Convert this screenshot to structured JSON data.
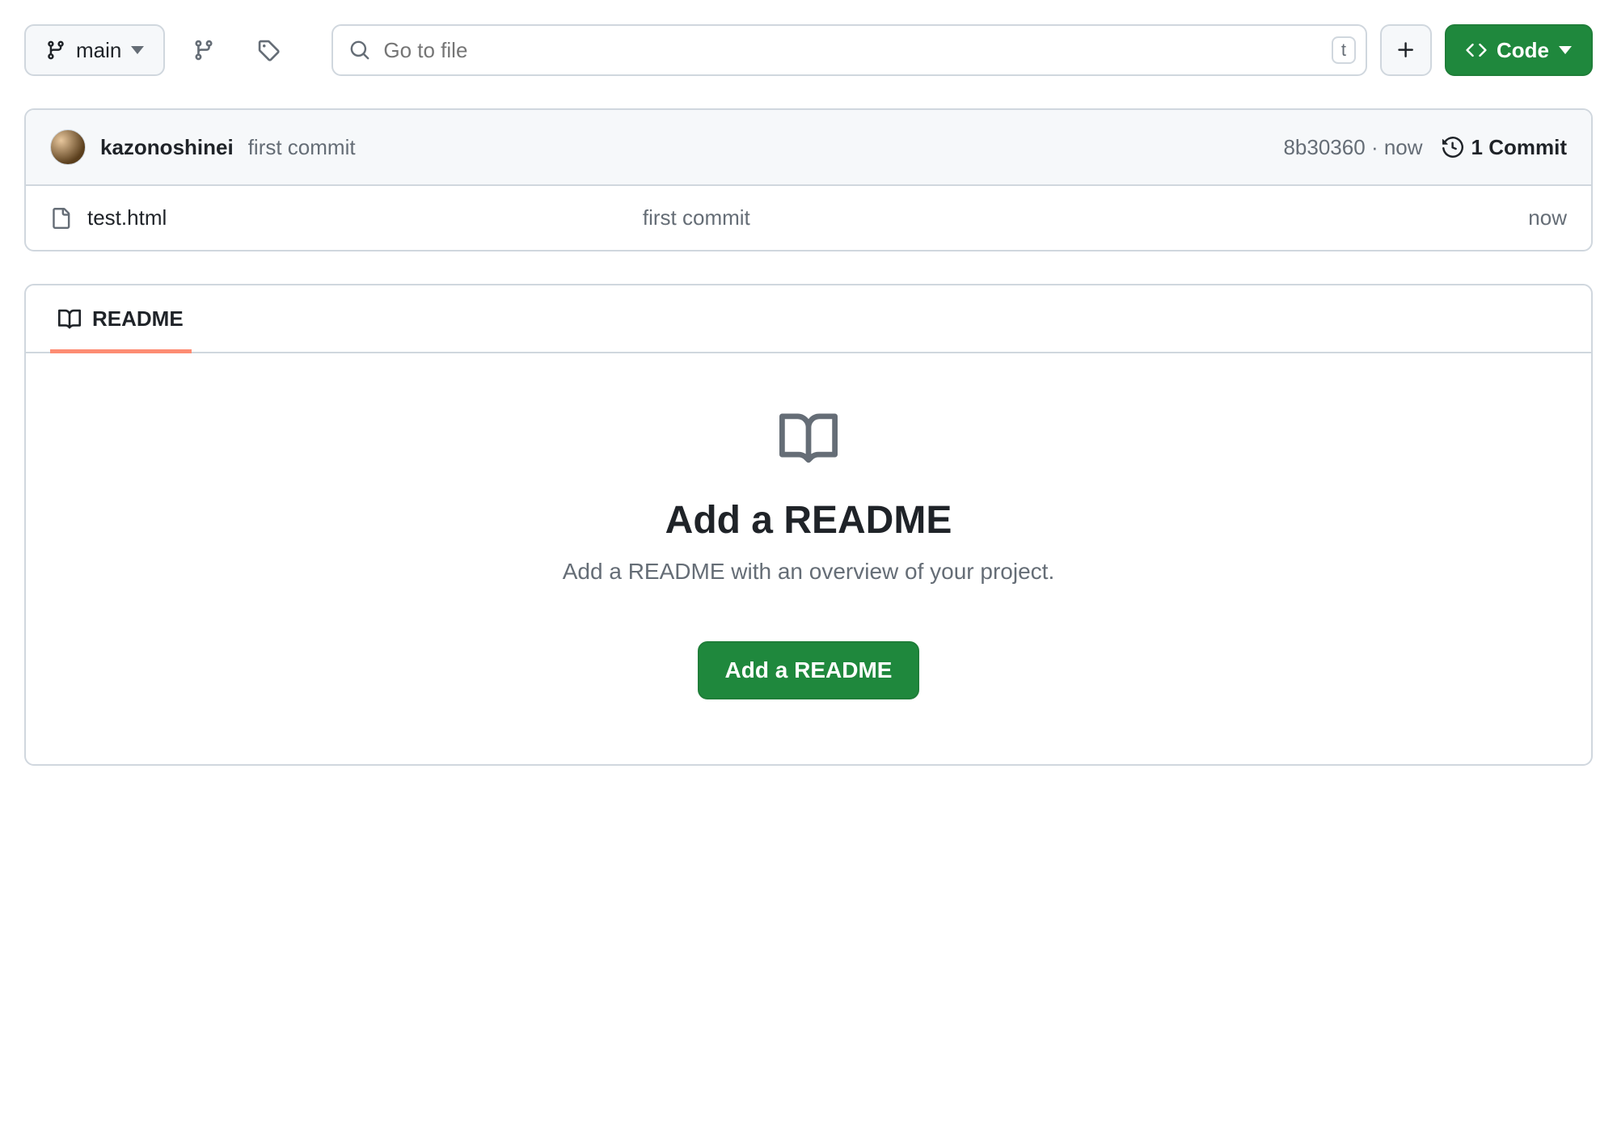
{
  "toolbar": {
    "branch_label": "main",
    "search_placeholder": "Go to file",
    "search_kbd": "t",
    "code_label": "Code"
  },
  "commit": {
    "author": "kazonoshinei",
    "message": "first commit",
    "sha": "8b30360",
    "time": "now",
    "count_label": "1 Commit"
  },
  "files": [
    {
      "name": "test.html",
      "message": "first commit",
      "time": "now"
    }
  ],
  "readme": {
    "tab_label": "README",
    "title": "Add a README",
    "description": "Add a README with an overview of your project.",
    "button_label": "Add a README"
  }
}
